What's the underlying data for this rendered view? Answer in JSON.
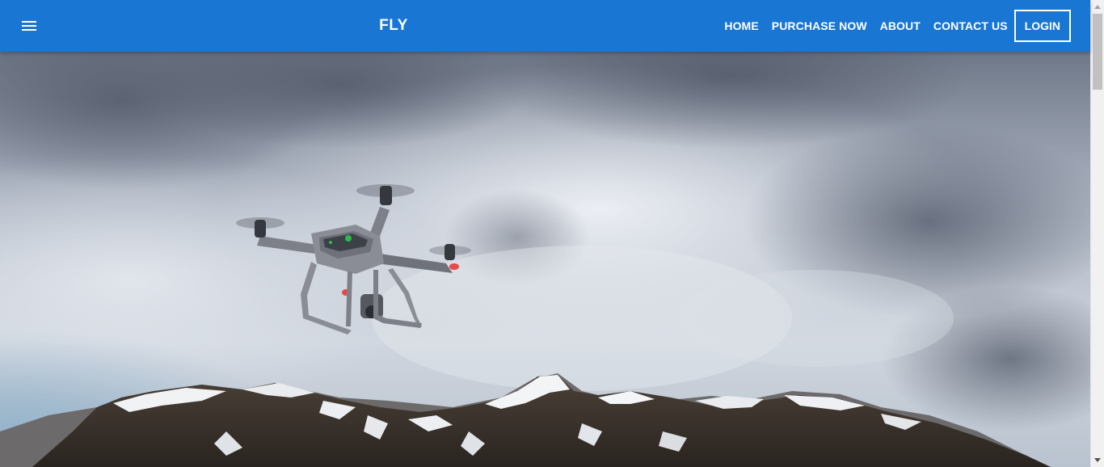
{
  "navbar": {
    "brand": "FLY",
    "menu_icon": "hamburger-menu-icon",
    "links": [
      "HOME",
      "PURCHASE NOW",
      "ABOUT",
      "CONTACT US"
    ],
    "login_label": "LOGIN",
    "background_color": "#1976d2"
  },
  "hero": {
    "image": "drone-over-snowy-mountains"
  }
}
